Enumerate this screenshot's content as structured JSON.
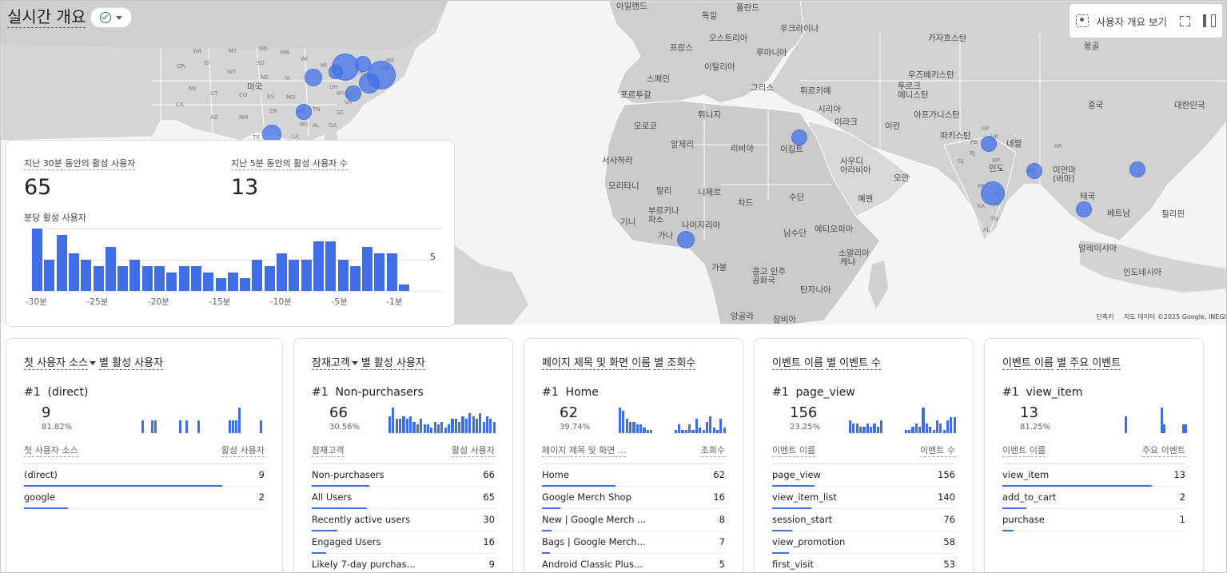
{
  "header": {
    "title": "실시간 개요",
    "toolbar_label": "사용자 개요 보기"
  },
  "icons": {
    "status": "check-circle-icon",
    "dropdown": "chevron-down-icon",
    "user_snapshot": "user-snapshot-icon",
    "fullscreen": "fullscreen-icon",
    "panel": "panel-icon"
  },
  "colors": {
    "accent": "#3f6ee6",
    "bubble": "#4271e8",
    "check": "#188038"
  },
  "map": {
    "labels": [
      {
        "t": "아일랜드"
      },
      {
        "t": "폴란드"
      },
      {
        "t": "독일"
      },
      {
        "t": "오스트리아"
      },
      {
        "t": "우크라이나"
      },
      {
        "t": "카자흐스탄"
      },
      {
        "t": "프랑스"
      },
      {
        "t": "루마니아"
      },
      {
        "t": "몽골"
      },
      {
        "t": "스페인"
      },
      {
        "t": "이탈리아"
      },
      {
        "t": "그리스"
      },
      {
        "t": "우즈베키스탄"
      },
      {
        "t": "포르투갈"
      },
      {
        "t": "튀르키예"
      },
      {
        "t": "투르크\n메니스탄"
      },
      {
        "t": "중국"
      },
      {
        "t": "대한민국"
      },
      {
        "t": "시리아"
      },
      {
        "t": "튀니지"
      },
      {
        "t": "아프가니스탄"
      },
      {
        "t": "모로코"
      },
      {
        "t": "이라크"
      },
      {
        "t": "이란"
      },
      {
        "t": "파키스탄"
      },
      {
        "t": "알제리"
      },
      {
        "t": "리비아"
      },
      {
        "t": "이집트"
      },
      {
        "t": "네팔"
      },
      {
        "t": "서사하라"
      },
      {
        "t": "사우디\n아라비아"
      },
      {
        "t": "인도"
      },
      {
        "t": "미얀마\n(버마)"
      },
      {
        "t": "모리타니"
      },
      {
        "t": "말리"
      },
      {
        "t": "니제르"
      },
      {
        "t": "오만"
      },
      {
        "t": "예멘"
      },
      {
        "t": "차드"
      },
      {
        "t": "수단"
      },
      {
        "t": "태국"
      },
      {
        "t": "베트남"
      },
      {
        "t": "필리핀"
      },
      {
        "t": "부르키나\n파소"
      },
      {
        "t": "나이지리아"
      },
      {
        "t": "가나"
      },
      {
        "t": "기니"
      },
      {
        "t": "에티오피아"
      },
      {
        "t": "남수단"
      },
      {
        "t": "소말리아"
      },
      {
        "t": "말레이시아"
      },
      {
        "t": "케냐"
      },
      {
        "t": "가봉"
      },
      {
        "t": "콩고 민주\n공화국"
      },
      {
        "t": "탄자니아"
      },
      {
        "t": "인도네시아"
      },
      {
        "t": "앙골라"
      },
      {
        "t": "잠비아"
      },
      {
        "t": "미국"
      },
      {
        "t": "WA"
      },
      {
        "t": "MT"
      },
      {
        "t": "ND"
      },
      {
        "t": "MN"
      },
      {
        "t": "OR"
      },
      {
        "t": "ID"
      },
      {
        "t": "SD"
      },
      {
        "t": "WI"
      },
      {
        "t": "MI"
      },
      {
        "t": "WY"
      },
      {
        "t": "NE"
      },
      {
        "t": "IA"
      },
      {
        "t": "NV"
      },
      {
        "t": "UT"
      },
      {
        "t": "CO"
      },
      {
        "t": "KS"
      },
      {
        "t": "MO"
      },
      {
        "t": "CA"
      },
      {
        "t": "AZ"
      },
      {
        "t": "NM"
      },
      {
        "t": "OK"
      },
      {
        "t": "AR"
      },
      {
        "t": "TN"
      },
      {
        "t": "MS"
      },
      {
        "t": "AL"
      },
      {
        "t": "GA"
      },
      {
        "t": "TX"
      },
      {
        "t": "LA"
      },
      {
        "t": "NC"
      },
      {
        "t": "SC"
      },
      {
        "t": "OH"
      },
      {
        "t": "WV"
      },
      {
        "t": "VA"
      },
      {
        "t": "NY"
      },
      {
        "t": "PA"
      },
      {
        "t": "ME"
      },
      {
        "t": "NH"
      },
      {
        "t": "HP"
      },
      {
        "t": "UK"
      },
      {
        "t": "PB"
      },
      {
        "t": "RJ"
      },
      {
        "t": "AR"
      },
      {
        "t": "GJ"
      },
      {
        "t": "MP"
      },
      {
        "t": "WB"
      },
      {
        "t": "MH"
      },
      {
        "t": "TS"
      },
      {
        "t": "KA"
      },
      {
        "t": "AP"
      },
      {
        "t": "TN"
      },
      {
        "t": "KL"
      }
    ],
    "shortcut_label": "단축키",
    "attribution": "지도 데이터 ©2025 Google, INEGI"
  },
  "realtime": {
    "metric1_label": "지난 30분 동안의 활성 사용자",
    "metric1_value": "65",
    "metric2_label": "지난 5분 동안의 활성 사용자 수",
    "metric2_value": "13",
    "per_minute_label": "분당 활성 사용자",
    "y_label": "5",
    "chart_data": {
      "type": "bar",
      "title": "분당 활성 사용자",
      "ylim": [
        0,
        10
      ],
      "values": [
        10,
        5,
        9,
        6,
        5,
        4,
        7,
        4,
        5,
        4,
        4,
        3,
        4,
        4,
        3,
        2,
        3,
        2,
        5,
        4,
        6,
        5,
        5,
        8,
        8,
        5,
        4,
        7,
        6,
        6,
        1
      ],
      "ticks": [
        "-30분",
        "-25분",
        "-20분",
        "-15분",
        "-10분",
        "-5분",
        "-1분"
      ]
    }
  },
  "cards": [
    {
      "title_main": "첫 사용자 소스",
      "title_rest": "별 활성 사용자",
      "has_dropdown": true,
      "top_rank": "#1",
      "top_name": "(direct)",
      "top_value": "9",
      "top_pct": "81.82%",
      "col1": "첫 사용자 소스",
      "col2": "활성 사용자",
      "rows": [
        {
          "name": "(direct)",
          "value": "9",
          "share": 0.82
        },
        {
          "name": "google",
          "value": "2",
          "share": 0.18
        }
      ],
      "spark": [
        0,
        0,
        0,
        0,
        0,
        1,
        0,
        0,
        1,
        1,
        0,
        0,
        0,
        0,
        0,
        0,
        0,
        1,
        0,
        1,
        0,
        0,
        0,
        1,
        0,
        0,
        0,
        0,
        0,
        0,
        0,
        0,
        0,
        1,
        1,
        1,
        2,
        0,
        0,
        0,
        0,
        0,
        0,
        1,
        0
      ]
    },
    {
      "title_main": "잠재고객",
      "title_rest": "별 활성 사용자",
      "has_dropdown": true,
      "top_rank": "#1",
      "top_name": "Non-purchasers",
      "top_value": "66",
      "top_pct": "30.56%",
      "col1": "잠재고객",
      "col2": "활성 사용자",
      "rows": [
        {
          "name": "Non-purchasers",
          "value": "66",
          "share": 0.31
        },
        {
          "name": "All Users",
          "value": "65",
          "share": 0.3
        },
        {
          "name": "Recently active users",
          "value": "30",
          "share": 0.14
        },
        {
          "name": "Engaged Users",
          "value": "16",
          "share": 0.08
        },
        {
          "name": "Likely 7-day purchas...",
          "value": "9",
          "share": 0.04
        }
      ],
      "spark": [
        6,
        9,
        5,
        5,
        6,
        5,
        6,
        4,
        3,
        5,
        3,
        3,
        2,
        4,
        3,
        4,
        2,
        3,
        5,
        5,
        4,
        6,
        5,
        7,
        6,
        5,
        7,
        4,
        6,
        5,
        4
      ]
    },
    {
      "title_main": "페이지 제목 및 화면 이름",
      "title_rest": "별 조회수",
      "has_dropdown": false,
      "top_rank": "#1",
      "top_name": "Home",
      "top_value": "62",
      "top_pct": "39.74%",
      "col1": "페이지 제목 및 화면 ...",
      "col2": "조회수",
      "rows": [
        {
          "name": "Home",
          "value": "62",
          "share": 0.4
        },
        {
          "name": "Google Merch Shop",
          "value": "16",
          "share": 0.1
        },
        {
          "name": "New | Google Merch ...",
          "value": "8",
          "share": 0.05
        },
        {
          "name": "Bags | Google Merch...",
          "value": "7",
          "share": 0.045
        },
        {
          "name": "Android Classic Plus...",
          "value": "5",
          "share": 0.03
        }
      ],
      "spark": [
        9,
        8,
        5,
        4,
        4,
        3,
        3,
        2,
        1,
        1,
        0,
        0,
        0,
        0,
        0,
        0,
        1,
        3,
        1,
        1,
        3,
        1,
        5,
        2,
        1,
        4,
        6,
        2,
        1,
        5,
        2
      ]
    },
    {
      "title_main": "이벤트 이름",
      "title_rest": "별 이벤트 수",
      "has_dropdown": false,
      "top_rank": "#1",
      "top_name": "page_view",
      "top_value": "156",
      "top_pct": "23.25%",
      "col1": "이벤트 이름",
      "col2": "이벤트 수",
      "rows": [
        {
          "name": "page_view",
          "value": "156",
          "share": 0.23
        },
        {
          "name": "view_item_list",
          "value": "140",
          "share": 0.21
        },
        {
          "name": "session_start",
          "value": "76",
          "share": 0.11
        },
        {
          "name": "view_promotion",
          "value": "58",
          "share": 0.09
        },
        {
          "name": "first_visit",
          "value": "53",
          "share": 0.08
        }
      ],
      "spark": [
        4,
        3,
        3,
        2,
        2,
        3,
        2,
        3,
        2,
        4,
        0,
        0,
        0,
        0,
        0,
        0,
        1,
        1,
        2,
        3,
        2,
        8,
        3,
        2,
        1,
        4,
        3,
        1,
        4,
        5,
        5
      ]
    },
    {
      "title_main": "이벤트 이름",
      "title_rest": "별 주요 이벤트",
      "has_dropdown": false,
      "top_rank": "#1",
      "top_name": "view_item",
      "top_value": "13",
      "top_pct": "81.25%",
      "col1": "이벤트 이름",
      "col2": "주요 이벤트",
      "rows": [
        {
          "name": "view_item",
          "value": "13",
          "share": 0.81
        },
        {
          "name": "add_to_cart",
          "value": "2",
          "share": 0.13
        },
        {
          "name": "purchase",
          "value": "1",
          "share": 0.06
        }
      ],
      "spark": [
        0,
        0,
        0,
        0,
        0,
        0,
        0,
        0,
        0,
        0,
        0,
        0,
        0,
        0,
        0,
        0,
        0,
        0,
        0,
        2,
        0,
        0,
        0,
        0,
        0,
        0,
        0,
        0,
        0,
        0,
        0,
        0,
        0,
        0,
        3,
        1,
        0,
        0,
        0,
        0,
        0,
        0,
        0,
        1,
        1
      ]
    }
  ]
}
